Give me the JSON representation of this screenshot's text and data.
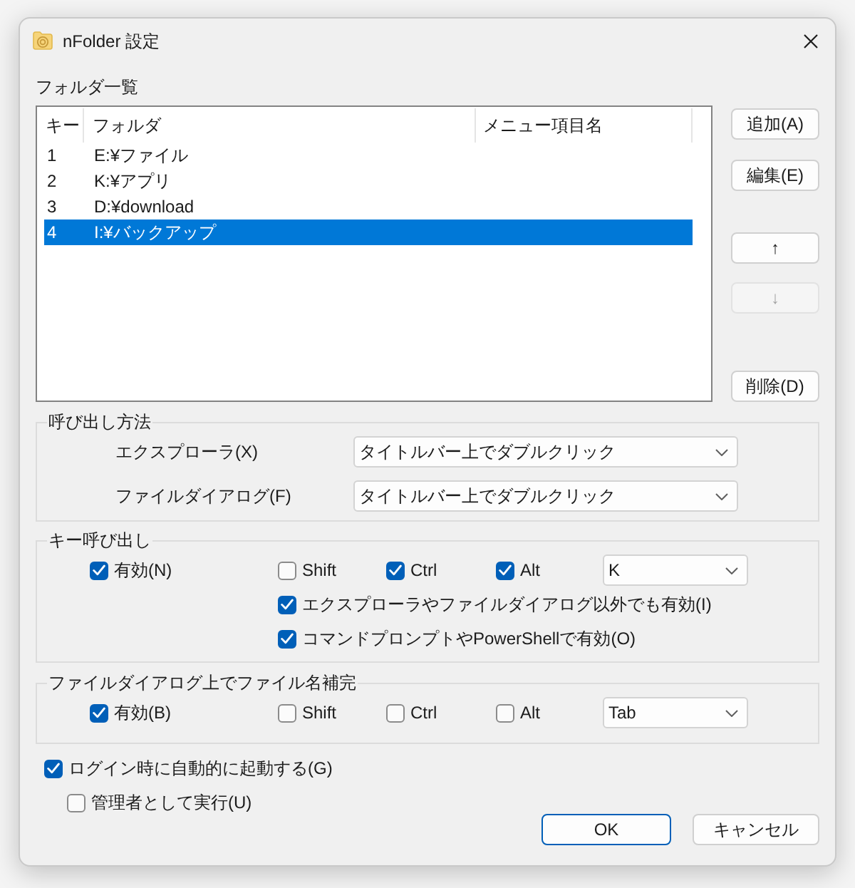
{
  "window": {
    "title": "nFolder 設定"
  },
  "folder_list": {
    "label": "フォルダ一覧",
    "columns": [
      "キー",
      "フォルダ",
      "メニュー項目名"
    ],
    "rows": [
      {
        "key": "1",
        "folder": "E:¥ファイル",
        "selected": false
      },
      {
        "key": "2",
        "folder": "K:¥アプリ",
        "selected": false
      },
      {
        "key": "3",
        "folder": "D:¥download",
        "selected": false
      },
      {
        "key": "4",
        "folder": "I:¥バックアップ",
        "selected": true
      }
    ]
  },
  "list_buttons": {
    "edit": [
      {
        "label": "追加(A)",
        "disabled": false
      },
      {
        "label": "編集(E)",
        "disabled": false
      }
    ],
    "move": [
      {
        "label": "↑",
        "disabled": false
      },
      {
        "label": "↓",
        "disabled": true
      }
    ],
    "delete": {
      "label": "削除(D)",
      "disabled": false
    }
  },
  "call_method": {
    "title": "呼び出し方法",
    "rows": [
      {
        "label": "エクスプローラ(X)",
        "value": "タイトルバー上でダブルクリック"
      },
      {
        "label": "ファイルダイアログ(F)",
        "value": "タイトルバー上でダブルクリック"
      }
    ]
  },
  "key_call": {
    "title": "キー呼び出し",
    "enabled": {
      "label": "有効(N)",
      "checked": true
    },
    "modifiers": [
      {
        "label": "Shift",
        "checked": false
      },
      {
        "label": "Ctrl",
        "checked": true
      },
      {
        "label": "Alt",
        "checked": true
      }
    ],
    "key": "K",
    "options": [
      {
        "label": "エクスプローラやファイルダイアログ以外でも有効(I)",
        "checked": true
      },
      {
        "label": "コマンドプロンプトやPowerShellで有効(O)",
        "checked": true
      }
    ]
  },
  "completion": {
    "title": "ファイルダイアログ上でファイル名補完",
    "enabled": {
      "label": "有効(B)",
      "checked": true
    },
    "modifiers": [
      {
        "label": "Shift",
        "checked": false
      },
      {
        "label": "Ctrl",
        "checked": false
      },
      {
        "label": "Alt",
        "checked": false
      }
    ],
    "key": "Tab"
  },
  "startup": {
    "label": "ログイン時に自動的に起動する(G)",
    "checked": true,
    "children": [
      {
        "label": "管理者として実行(U)",
        "checked": false
      }
    ]
  },
  "buttons": [
    {
      "label": "OK",
      "default": true
    },
    {
      "label": "キャンセル",
      "default": false
    }
  ]
}
